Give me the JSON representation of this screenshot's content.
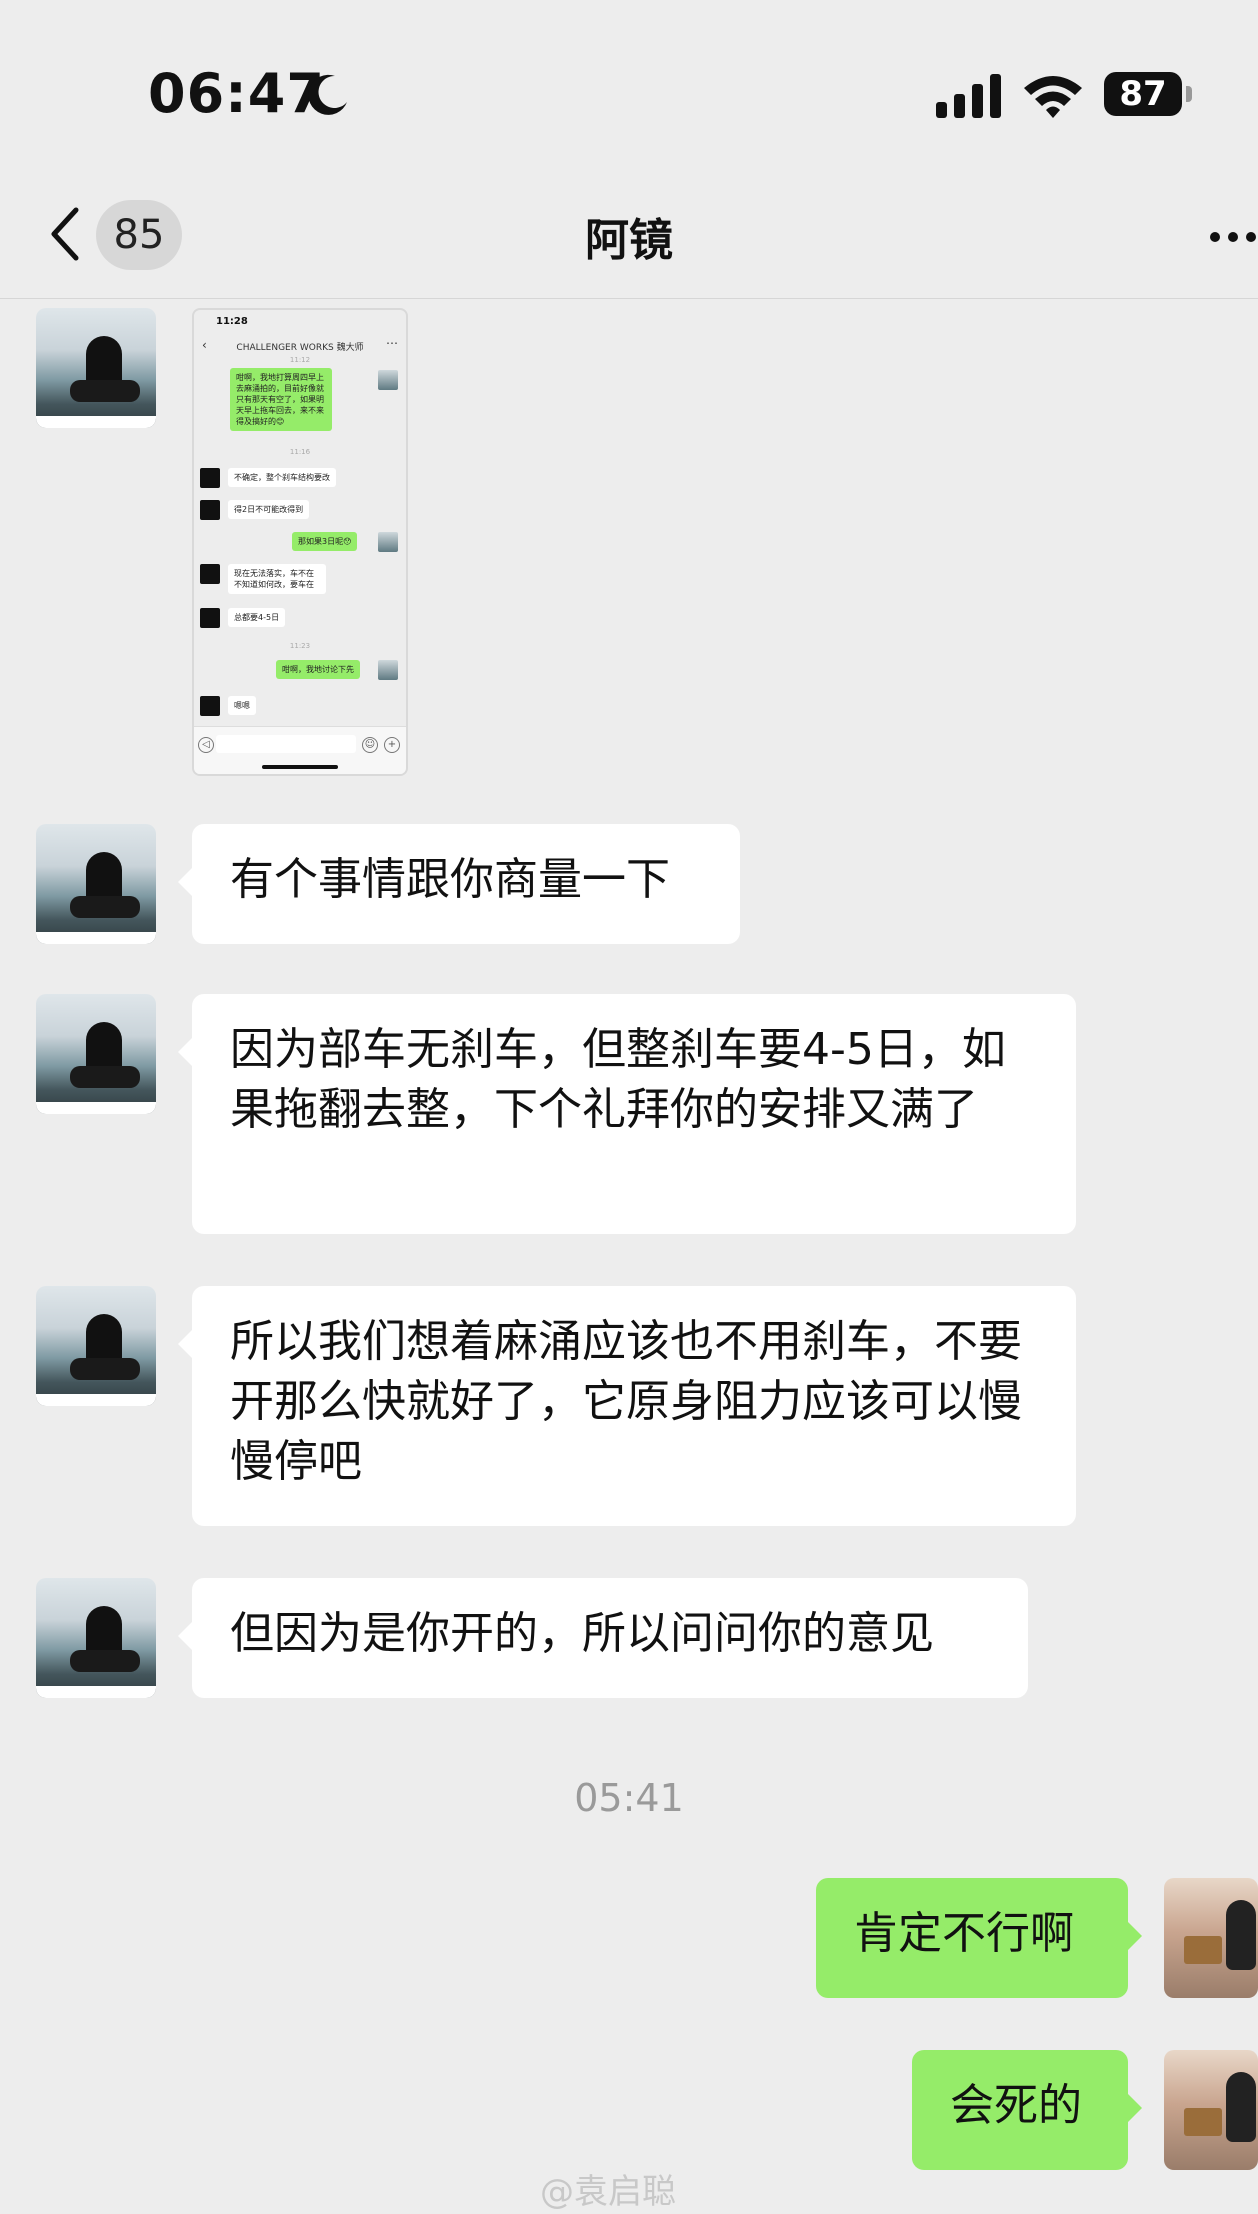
{
  "status_bar": {
    "time": "06:47",
    "battery": "87"
  },
  "nav": {
    "back_count": "85",
    "title": "阿镜"
  },
  "screenshot_preview": {
    "time": "11:28",
    "title": "CHALLENGER WORKS 魏大师",
    "messages": [
      {
        "ts": "11:12"
      },
      {
        "text": "咁啊，我地打算周四早上去麻涌拍的，目前好像就只有那天有空了，如果明天早上拖车回去，来不来得及搞好的😊",
        "me": true
      },
      {
        "ts": "11:16"
      },
      {
        "text": "不确定，整个刹车结构要改",
        "me": false
      },
      {
        "text": "得2日不可能改得到",
        "me": false
      },
      {
        "text": "那如果3日呢😯",
        "me": true
      },
      {
        "text": "现在无法落实，车不在不知道如何改，要车在",
        "me": false
      },
      {
        "text": "总都要4-5日",
        "me": false
      },
      {
        "ts": "11:23"
      },
      {
        "text": "咁啊，我地讨论下先",
        "me": true
      },
      {
        "text": "嗯嗯",
        "me": false
      }
    ]
  },
  "messages": [
    {
      "text": "有个事情跟你商量一下"
    },
    {
      "text": "因为部车无刹车，但整刹车要4-5日，如果拖翻去整，下个礼拜你的安排又满了"
    },
    {
      "text": "所以我们想着麻涌应该也不用刹车，不要开那么快就好了，它原身阻力应该可以慢慢停吧"
    },
    {
      "text": "但因为是你开的，所以问问你的意见"
    }
  ],
  "timestamp": "05:41",
  "my_messages": [
    {
      "text": "肯定不行啊"
    },
    {
      "text": "会死的"
    }
  ],
  "watermark": "@袁启聪"
}
